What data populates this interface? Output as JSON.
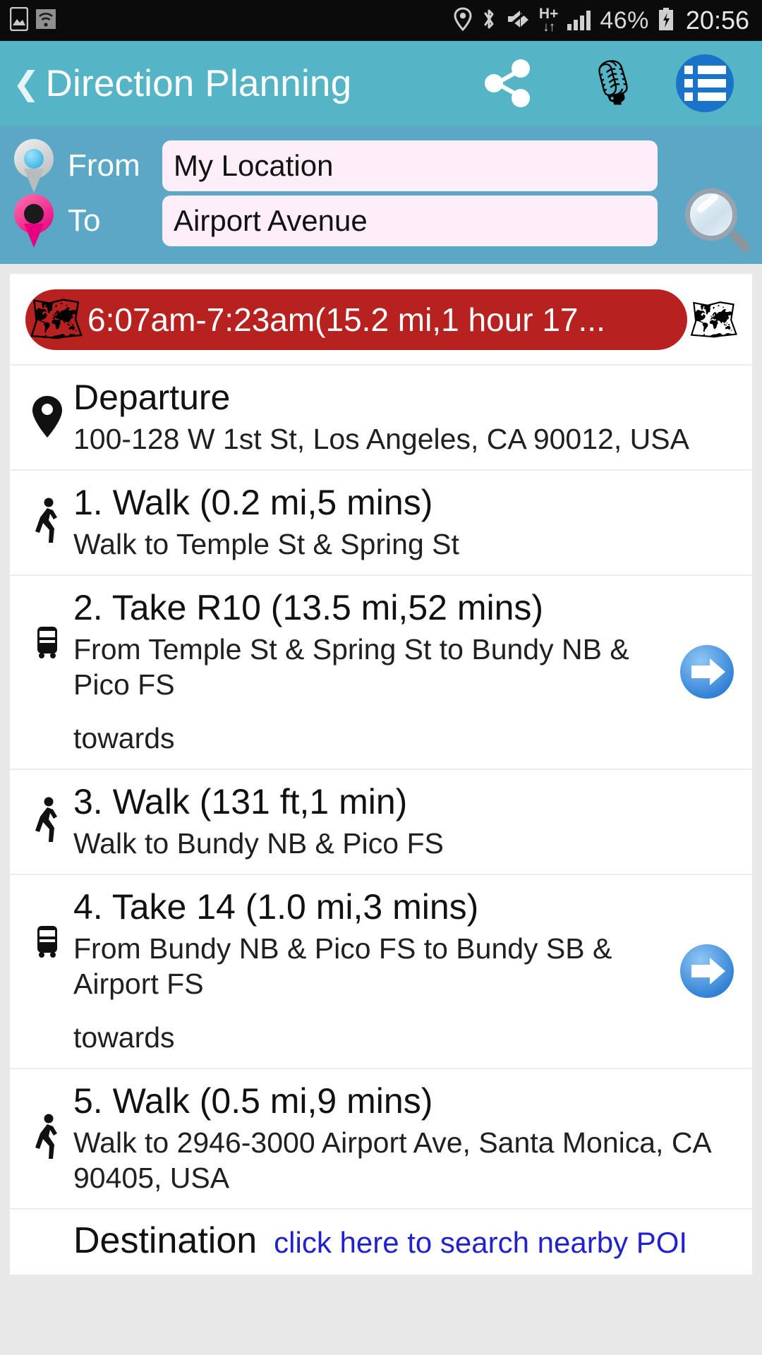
{
  "status_bar": {
    "left_icons": [
      "screenshot-icon",
      "wifi-icon"
    ],
    "right_icons": [
      "location-icon",
      "bluetooth-icon",
      "mute-icon",
      "hplus-data-icon",
      "signal-icon"
    ],
    "data_label_top": "H+",
    "battery_percent": "46%",
    "clock": "20:56"
  },
  "appbar": {
    "back_glyph": "❮",
    "title": "Direction Planning",
    "share_icon": "share-icon",
    "mic_icon": "🎙",
    "list_icon": "list-icon"
  },
  "search_panel": {
    "from_label": "From",
    "from_value": "My Location",
    "from_placeholder": "From",
    "to_label": "To",
    "to_value": "Airport Avenue",
    "to_placeholder": "To",
    "search_icon": "magnifier-icon"
  },
  "summary": {
    "route_emoji": "🗺",
    "text": "6:07am-7:23am(15.2 mi,1 hour 17…)",
    "display_text": "6:07am-7:23am(15.2 mi,1 hour 17...",
    "map_icon": "🗺",
    "pill_color": "#b7211f"
  },
  "departure": {
    "icon": "map-pin-icon",
    "title": "Departure",
    "address": "100-128 W 1st St, Los Angeles, CA 90012, USA"
  },
  "steps": [
    {
      "icon": "walking-person-icon",
      "title": "1. Walk (0.2 mi,5 mins)",
      "detail": "Walk to Temple St & Spring St",
      "towards": null,
      "has_arrow": false
    },
    {
      "icon": "bus-icon",
      "title": "2. Take R10 (13.5 mi,52 mins)",
      "detail": "From Temple St & Spring St to Bundy NB & Pico FS",
      "towards": "towards",
      "has_arrow": true
    },
    {
      "icon": "walking-person-icon",
      "title": "3. Walk (131 ft,1 min)",
      "detail": "Walk to Bundy NB & Pico FS",
      "towards": null,
      "has_arrow": false
    },
    {
      "icon": "bus-icon",
      "title": "4. Take 14 (1.0 mi,3 mins)",
      "detail": "From Bundy NB & Pico FS to Bundy SB & Airport FS",
      "towards": "towards",
      "has_arrow": true
    },
    {
      "icon": "walking-person-icon",
      "title": "5. Walk (0.5 mi,9 mins)",
      "detail": "Walk to 2946-3000 Airport Ave, Santa Monica, CA 90405, USA",
      "towards": null,
      "has_arrow": false
    }
  ],
  "destination": {
    "title": "Destination",
    "poi_link": "click here to search nearby POI"
  },
  "colors": {
    "appbar": "#55b4c6",
    "panel": "#5ba8c6",
    "pill_red": "#b7211f",
    "link_blue": "#2222cc",
    "accent_blue": "#1a73c8"
  }
}
